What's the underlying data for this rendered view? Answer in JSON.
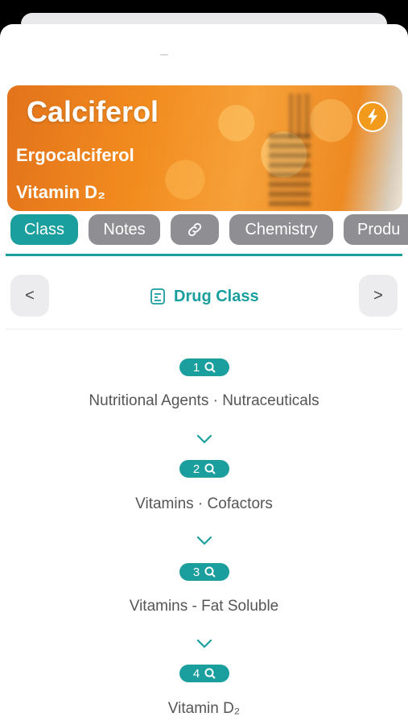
{
  "drug": {
    "name": "Calciferol",
    "synonyms": [
      "Ergocalciferol",
      "Vitamin D₂"
    ]
  },
  "tabs": [
    {
      "label": "Class",
      "active": true
    },
    {
      "label": "Notes",
      "active": false
    },
    {
      "icon": "link-icon",
      "label": "",
      "active": false
    },
    {
      "label": "Chemistry",
      "active": false
    },
    {
      "label": "Produ",
      "active": false
    }
  ],
  "section": {
    "title": "Drug Class",
    "prev_label": "<",
    "next_label": ">"
  },
  "hierarchy": [
    {
      "level": "1",
      "text": "Nutritional Agents · Nutraceuticals"
    },
    {
      "level": "2",
      "text": "Vitamins · Cofactors"
    },
    {
      "level": "3",
      "text": "Vitamins - Fat Soluble"
    },
    {
      "level": "4",
      "text": "Vitamin D₂"
    }
  ],
  "colors": {
    "accent": "#1a9e9e",
    "tab_inactive": "#8e8e93",
    "hero_orange": "#f28c1f"
  }
}
